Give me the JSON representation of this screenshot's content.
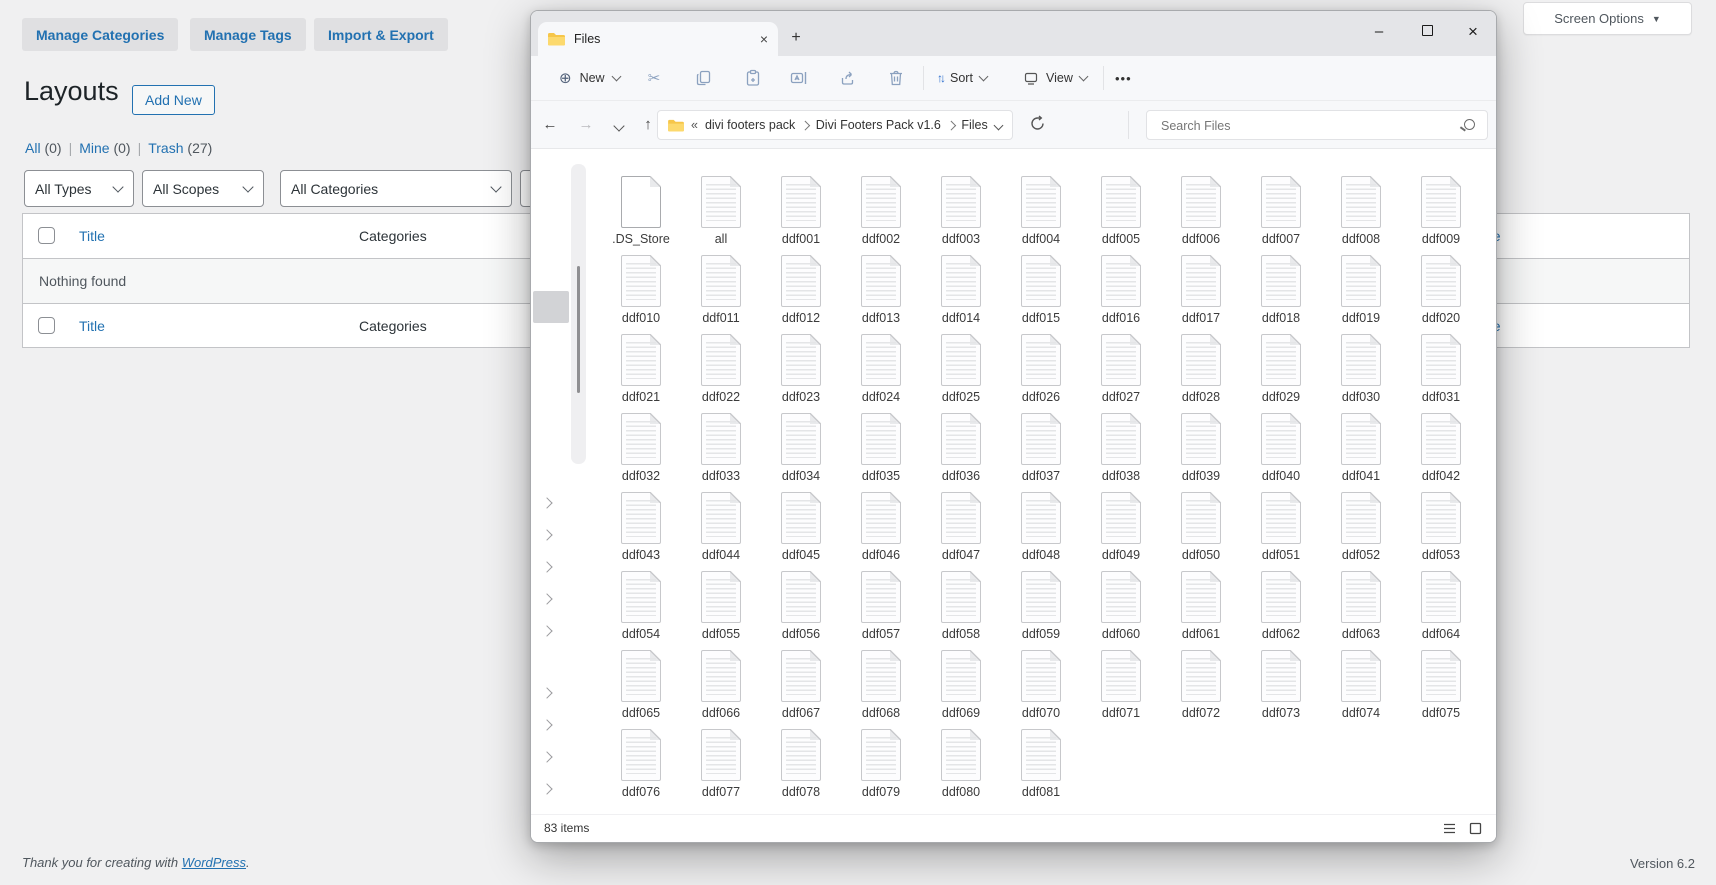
{
  "wp": {
    "actions": [
      "Manage Categories",
      "Manage Tags",
      "Import & Export"
    ],
    "page_title": "Layouts",
    "add_new_label": "Add New",
    "views": [
      {
        "label": "All",
        "count": "(0)"
      },
      {
        "label": "Mine",
        "count": "(0)"
      },
      {
        "label": "Trash",
        "count": "(27)"
      }
    ],
    "view_separator": "|",
    "filters": [
      "All Types",
      "All Scopes",
      "All Categories"
    ],
    "table": {
      "title_col": "Title",
      "categories_col": "Categories",
      "date_col": "Date",
      "empty_message": "Nothing found"
    },
    "footer": {
      "thanks_text": "Thank you for creating with",
      "wordpress_link": "WordPress",
      "suffix": ".",
      "version": "Version 6.2"
    },
    "screen_options_label": "Screen Options"
  },
  "explorer": {
    "tab_title": "Files",
    "toolbar": {
      "new_label": "New",
      "sort_label": "Sort",
      "view_label": "View",
      "more_label": "•••"
    },
    "address": {
      "overflow_indicator": "«",
      "crumbs": [
        "divi footers pack",
        "Divi Footers Pack v1.6",
        "Files"
      ]
    },
    "search_placeholder": "Search Files",
    "status_items": "83 items",
    "files": [
      ".DS_Store",
      "all",
      "ddf001",
      "ddf002",
      "ddf003",
      "ddf004",
      "ddf005",
      "ddf006",
      "ddf007",
      "ddf008",
      "ddf009",
      "ddf010",
      "ddf011",
      "ddf012",
      "ddf013",
      "ddf014",
      "ddf015",
      "ddf016",
      "ddf017",
      "ddf018",
      "ddf019",
      "ddf020",
      "ddf021",
      "ddf022",
      "ddf023",
      "ddf024",
      "ddf025",
      "ddf026",
      "ddf027",
      "ddf028",
      "ddf029",
      "ddf030",
      "ddf031",
      "ddf032",
      "ddf033",
      "ddf034",
      "ddf035",
      "ddf036",
      "ddf037",
      "ddf038",
      "ddf039",
      "ddf040",
      "ddf041",
      "ddf042",
      "ddf043",
      "ddf044",
      "ddf045",
      "ddf046",
      "ddf047",
      "ddf048",
      "ddf049",
      "ddf050",
      "ddf051",
      "ddf052",
      "ddf053",
      "ddf054",
      "ddf055",
      "ddf056",
      "ddf057",
      "ddf058",
      "ddf059",
      "ddf060",
      "ddf061",
      "ddf062",
      "ddf063",
      "ddf064",
      "ddf065",
      "ddf066",
      "ddf067",
      "ddf068",
      "ddf069",
      "ddf070",
      "ddf071",
      "ddf072",
      "ddf073",
      "ddf074",
      "ddf075",
      "ddf076",
      "ddf077",
      "ddf078",
      "ddf079",
      "ddf080",
      "ddf081"
    ]
  },
  "icons": {
    "back": "←",
    "forward": "→",
    "up": "↑",
    "minimize": "–",
    "close": "×",
    "tab_close": "×",
    "new_tab": "+",
    "new_plus": "⊕",
    "scissors": "✂",
    "sort_up": "↑",
    "sort_down": "↓",
    "screen_options_arrow": "▼"
  },
  "colors": {
    "wp_accent": "#2271b1",
    "page_background": "#f0f0f1",
    "explorer_icon_blue": "#8ba1bf",
    "sort_arrow_blue": "#2e6fce"
  }
}
